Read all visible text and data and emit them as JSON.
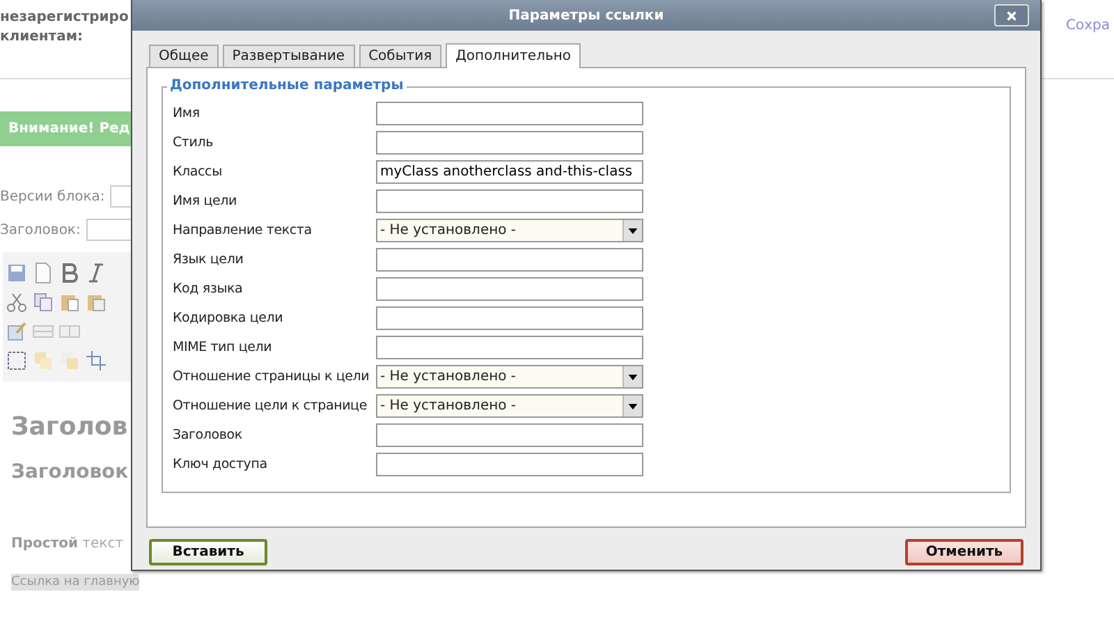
{
  "page": {
    "header_lines": [
      "незарегистриро",
      "клиентам:"
    ],
    "save_link": "Сохра",
    "notice": "Внимание! Ред",
    "block_versions_label": "Версии блока:",
    "title_label": "Заголовок:",
    "editor": {
      "heading1": "Заголов",
      "heading2": "Заголовок",
      "paragraph": "**Простой** текст",
      "link": "Ссылка на главную"
    }
  },
  "dialog": {
    "title": "Параметры ссылки",
    "tabs": [
      {
        "label": "Общее",
        "selected": false
      },
      {
        "label": "Развертывание",
        "selected": false
      },
      {
        "label": "События",
        "selected": false
      },
      {
        "label": "Дополнительно",
        "selected": true
      }
    ],
    "legend": "Дополнительные параметры",
    "fields": [
      {
        "label": "Имя",
        "kind": "text"
      },
      {
        "label": "Стиль",
        "kind": "text"
      },
      {
        "label": "Классы",
        "kind": "text",
        "value": "myClass anotherclass and-this-class"
      },
      {
        "label": "Имя цели",
        "kind": "text"
      },
      {
        "label": "Направление текста",
        "kind": "select",
        "value": "- Не установлено -"
      },
      {
        "label": "Язык цели",
        "kind": "text"
      },
      {
        "label": "Код языка",
        "kind": "text"
      },
      {
        "label": "Кодировка цели",
        "kind": "text"
      },
      {
        "label": "MIME тип цели",
        "kind": "text"
      },
      {
        "label": "Отношение страницы к цели",
        "kind": "select",
        "value": "- Не установлено -"
      },
      {
        "label": "Отношение цели к странице",
        "kind": "select",
        "value": "- Не установлено -"
      },
      {
        "label": "Заголовок",
        "kind": "text"
      },
      {
        "label": "Ключ доступа",
        "kind": "text"
      }
    ],
    "buttons": [
      {
        "label": "Вставить",
        "kind": "confirm"
      },
      {
        "label": "Отменить",
        "kind": "cancel"
      }
    ]
  }
}
